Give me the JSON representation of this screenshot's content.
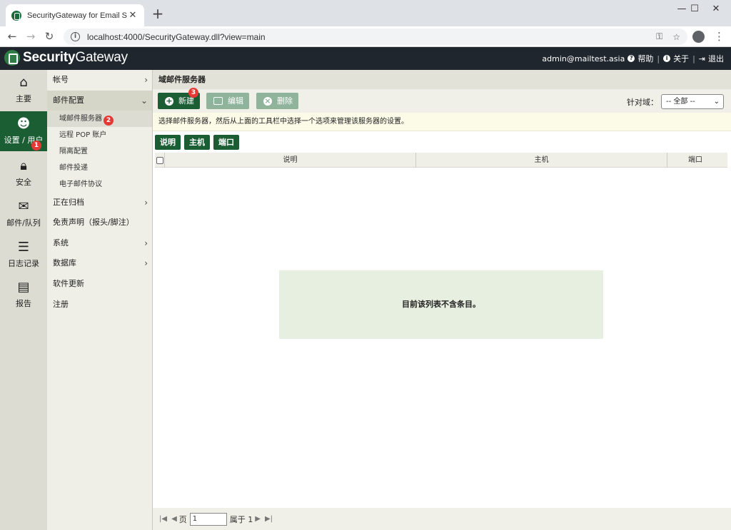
{
  "browser": {
    "tab_title": "SecurityGateway for Email Ser",
    "url": "localhost:4000/SecurityGateway.dll?view=main"
  },
  "app": {
    "brand_bold": "Security",
    "brand_rest": "Gateway",
    "user": "admin@mailtest.asia",
    "help": "帮助",
    "about": "关于",
    "logout": "退出"
  },
  "leftnav": [
    {
      "label": "主要",
      "icon": "home-icon"
    },
    {
      "label": "设置 / 用户",
      "icon": "users-icon"
    },
    {
      "label": "安全",
      "icon": "lock-icon"
    },
    {
      "label": "邮件/队列",
      "icon": "envelope-icon"
    },
    {
      "label": "日志记录",
      "icon": "list-icon"
    },
    {
      "label": "报告",
      "icon": "report-icon"
    }
  ],
  "sidebar": {
    "accounts": "帐号",
    "mail_config": "邮件配置",
    "sub": [
      "域邮件服务器",
      "远程 POP 账户",
      "隔离配置",
      "邮件投递",
      "电子邮件协议"
    ],
    "archiving": "正在归档",
    "disclaimer": "免责声明（报头/脚注）",
    "system": "系统",
    "database": "数据库",
    "updates": "软件更新",
    "register": "注册"
  },
  "main": {
    "title": "域邮件服务器",
    "new_label": "新建",
    "edit_label": "编辑",
    "delete_label": "删除",
    "domain_label": "针对域：",
    "domain_value": "-- 全部 --",
    "hint": "选择邮件服务器，然后从上面的工具栏中选择一个选项来管理该服务器的设置。",
    "col_buttons": [
      "说明",
      "主机",
      "端口"
    ],
    "columns": [
      "说明",
      "主机",
      "端口"
    ],
    "empty": "目前该列表不含条目。",
    "pager_page": "页",
    "pager_value": "1",
    "pager_of": "属于 1"
  },
  "badges": [
    "1",
    "2",
    "3"
  ],
  "colors": {
    "accent": "#1b5e34",
    "header_bg": "#20262d",
    "badge": "#e53935"
  }
}
